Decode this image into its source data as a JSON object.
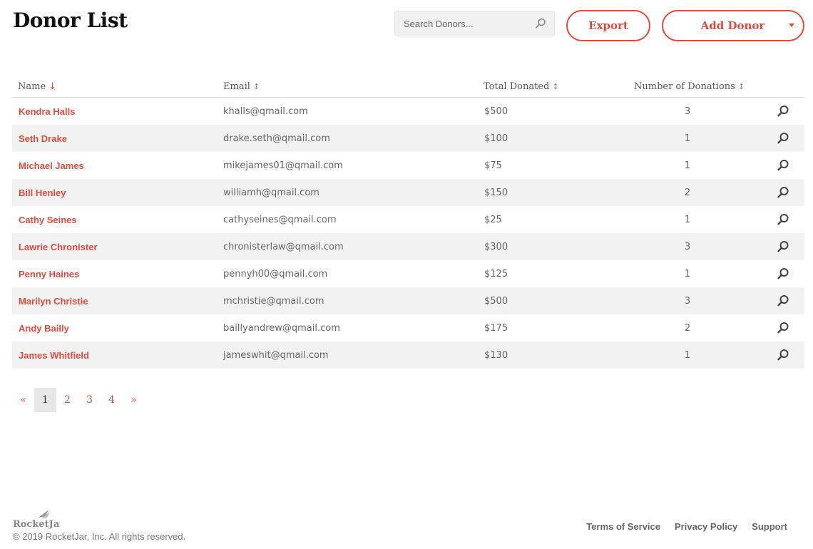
{
  "header": {
    "title": "Donor List",
    "search_placeholder": "Search Donors...",
    "search_value": "",
    "export_label": "Export",
    "add_label": "Add Donor"
  },
  "colors": {
    "accent": "#e04b3c",
    "row_alt": "#f2f2f2"
  },
  "table": {
    "columns": [
      {
        "label": "Name",
        "sort": "↓"
      },
      {
        "label": "Email",
        "sort": "↕"
      },
      {
        "label": "Total Donated",
        "sort": "↕"
      },
      {
        "label": "Number of Donations",
        "sort": "↕"
      }
    ],
    "rows": [
      {
        "name": "Kendra Halls",
        "email": "khalls@qmail.com",
        "total": "$500",
        "count": "3"
      },
      {
        "name": "Seth Drake",
        "email": "drake.seth@qmail.com",
        "total": "$100",
        "count": "1"
      },
      {
        "name": "Michael James",
        "email": "mikejames01@qmail.com",
        "total": "$75",
        "count": "1"
      },
      {
        "name": "Bill Henley",
        "email": "williamh@qmail.com",
        "total": "$150",
        "count": "2"
      },
      {
        "name": "Cathy Seines",
        "email": "cathyseines@qmail.com",
        "total": "$25",
        "count": "1"
      },
      {
        "name": "Lawrie Chronister",
        "email": "chronisterlaw@qmail.com",
        "total": "$300",
        "count": "3"
      },
      {
        "name": "Penny Haines",
        "email": "pennyh00@qmail.com",
        "total": "$125",
        "count": "1"
      },
      {
        "name": "Marilyn Christie",
        "email": "mchristie@qmail.com",
        "total": "$500",
        "count": "3"
      },
      {
        "name": "Andy Bailly",
        "email": "baillyandrew@qmail.com",
        "total": "$175",
        "count": "2"
      },
      {
        "name": "James Whitfield",
        "email": "jameswhit@qmail.com",
        "total": "$130",
        "count": "1"
      }
    ],
    "row_icon": "magnifier-icon"
  },
  "pagination": {
    "prev": "«",
    "pages": [
      "1",
      "2",
      "3",
      "4"
    ],
    "current": "1",
    "next": "»"
  },
  "footer": {
    "logo_text": "RocketJar",
    "copyright": "© 2019 RocketJar, Inc. All rights reserved.",
    "links": [
      "Terms of Service",
      "Privacy Policy",
      "Support"
    ]
  }
}
